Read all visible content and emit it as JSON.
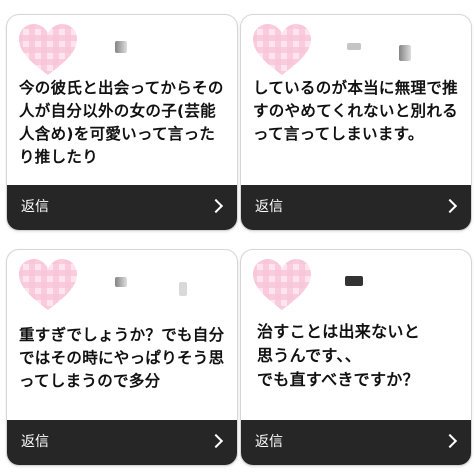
{
  "cards": [
    {
      "message": "今の彼氏と出会ってからその人が自分以外の女の子(芸能人含め)を可愛いって言ったり推したり",
      "reply_label": "返信"
    },
    {
      "message": "しているのが本当に無理で推すのやめてくれないと別れるって言ってしまいます。",
      "reply_label": "返信"
    },
    {
      "message": "重すぎでしょうか？でも自分ではその時にやっぱりそう思ってしまうので多分",
      "reply_label": "返信"
    },
    {
      "message": "治すことは出来ないと\n思うんです、、\nでも直すべきですか？",
      "reply_label": "返信"
    }
  ],
  "colors": {
    "heart_pink": "#f6b6cf",
    "heart_light": "#fde4ee",
    "reply_bar": "#262626"
  },
  "icons": {
    "avatar": "heart-icon",
    "reply_arrow": "chevron-right-icon"
  }
}
